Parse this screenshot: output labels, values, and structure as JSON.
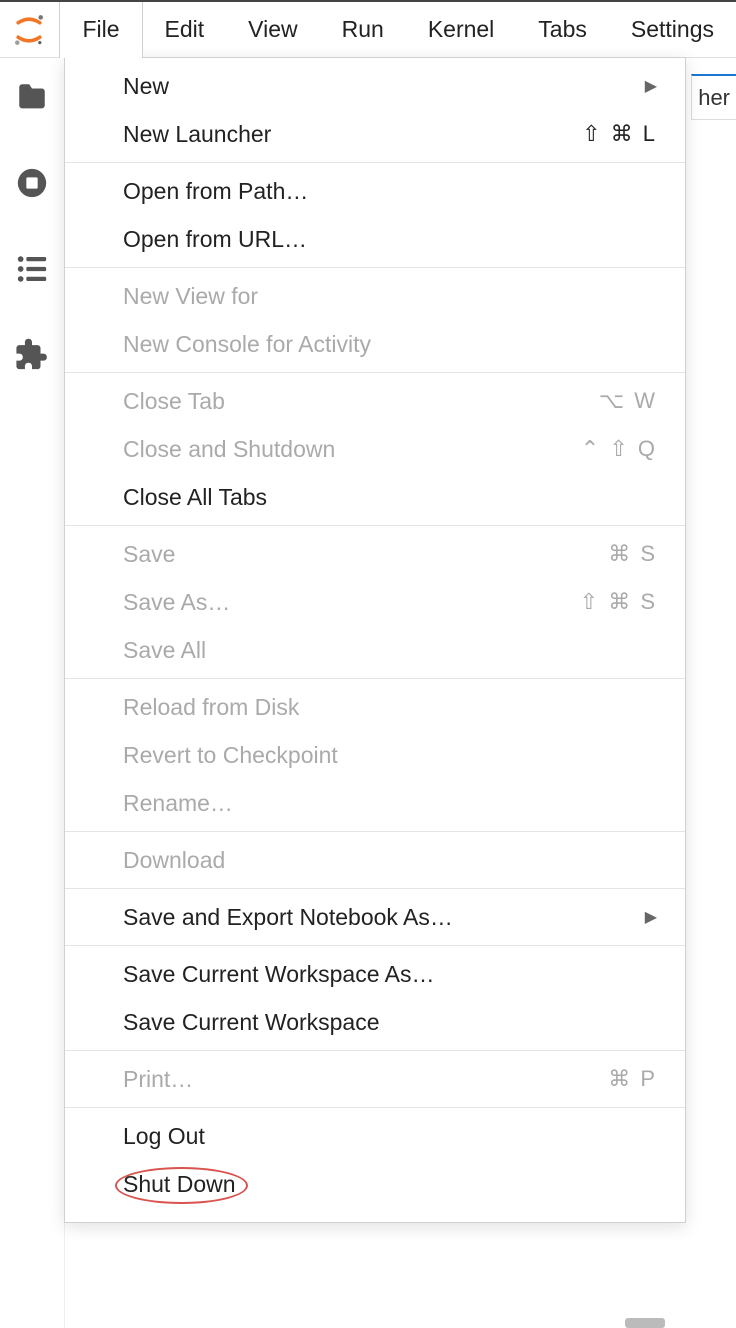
{
  "menubar": {
    "items": [
      {
        "label": "File",
        "active": true
      },
      {
        "label": "Edit"
      },
      {
        "label": "View"
      },
      {
        "label": "Run"
      },
      {
        "label": "Kernel"
      },
      {
        "label": "Tabs"
      },
      {
        "label": "Settings"
      }
    ]
  },
  "partial_tab_text": "her",
  "file_menu": {
    "groups": [
      [
        {
          "label": "New",
          "submenu": true
        },
        {
          "label": "New Launcher",
          "shortcut": "⇧ ⌘ L"
        }
      ],
      [
        {
          "label": "Open from Path…"
        },
        {
          "label": "Open from URL…"
        }
      ],
      [
        {
          "label": "New View for",
          "disabled": true
        },
        {
          "label": "New Console for Activity",
          "disabled": true
        }
      ],
      [
        {
          "label": "Close Tab",
          "shortcut": "⌥ W",
          "disabled": true
        },
        {
          "label": "Close and Shutdown",
          "shortcut": "⌃ ⇧ Q",
          "disabled": true
        },
        {
          "label": "Close All Tabs"
        }
      ],
      [
        {
          "label": "Save",
          "shortcut": "⌘ S",
          "disabled": true
        },
        {
          "label": "Save As…",
          "shortcut": "⇧ ⌘ S",
          "disabled": true
        },
        {
          "label": "Save All",
          "disabled": true
        }
      ],
      [
        {
          "label": "Reload from Disk",
          "disabled": true
        },
        {
          "label": "Revert to Checkpoint",
          "disabled": true
        },
        {
          "label": "Rename…",
          "disabled": true
        }
      ],
      [
        {
          "label": "Download",
          "disabled": true
        }
      ],
      [
        {
          "label": "Save and Export Notebook As…",
          "submenu": true
        }
      ],
      [
        {
          "label": "Save Current Workspace As…"
        },
        {
          "label": "Save Current Workspace"
        }
      ],
      [
        {
          "label": "Print…",
          "shortcut": "⌘ P",
          "disabled": true
        }
      ],
      [
        {
          "label": "Log Out"
        },
        {
          "label": "Shut Down",
          "highlight": true
        }
      ]
    ]
  }
}
